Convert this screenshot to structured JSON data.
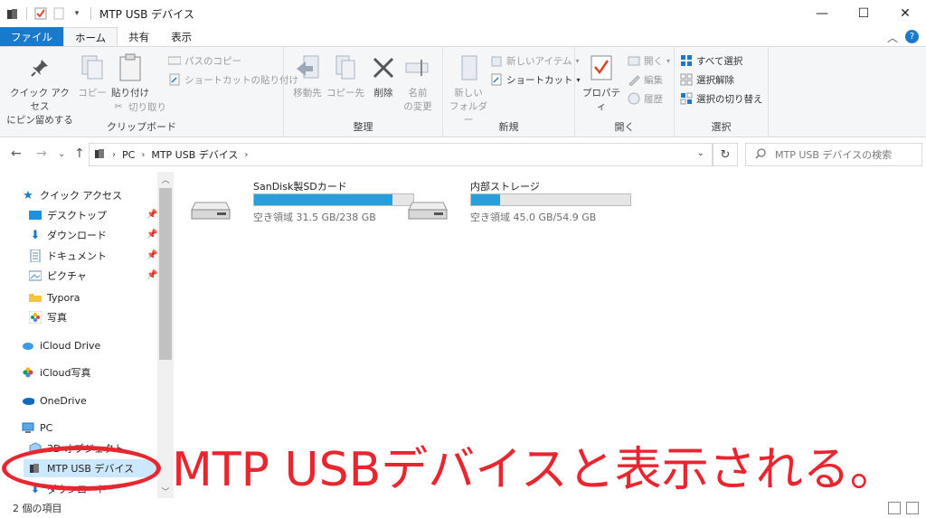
{
  "window": {
    "title": "MTP USB デバイス",
    "controls": {
      "minimize": "—",
      "maximize": "☐",
      "close": "✕"
    }
  },
  "ribbon_tabs": [
    {
      "label": "ファイル"
    },
    {
      "label": "ホーム"
    },
    {
      "label": "共有"
    },
    {
      "label": "表示"
    }
  ],
  "ribbon": {
    "clipboard": {
      "label": "クリップボード",
      "pin": "クイック アクセス\nにピン留めする",
      "copy": "コピー",
      "paste": "貼り付け",
      "copy_path": "パスのコピー",
      "paste_shortcut": "ショートカットの貼り付け",
      "cut": "切り取り"
    },
    "organize": {
      "label": "整理",
      "move_to": "移動先",
      "copy_to": "コピー先",
      "delete": "削除",
      "rename": "名前\nの変更"
    },
    "new": {
      "label": "新規",
      "new_folder": "新しい\nフォルダー",
      "new_item": "新しいアイテム",
      "shortcut": "ショートカット"
    },
    "open": {
      "label": "開く",
      "properties": "プロパティ",
      "open": "開く",
      "edit": "編集",
      "history": "履歴"
    },
    "select": {
      "label": "選択",
      "select_all": "すべて選択",
      "select_none": "選択解除",
      "invert": "選択の切り替え"
    }
  },
  "address": {
    "crumbs": [
      "PC",
      "MTP USB デバイス"
    ],
    "search_placeholder": "MTP USB デバイスの検索"
  },
  "nav": {
    "quick_access": "クイック アクセス",
    "items": [
      {
        "label": "デスクトップ",
        "pinned": true
      },
      {
        "label": "ダウンロード",
        "pinned": true
      },
      {
        "label": "ドキュメント",
        "pinned": true
      },
      {
        "label": "ピクチャ",
        "pinned": true
      },
      {
        "label": "Typora",
        "pinned": false
      },
      {
        "label": "写真",
        "pinned": false
      }
    ],
    "icloud_drive": "iCloud Drive",
    "icloud_photos": "iCloud写真",
    "onedrive": "OneDrive",
    "pc": "PC",
    "objects3d": "3D オブジェクト",
    "mtp": "MTP USB デバイス",
    "downloads2": "ダウンロード"
  },
  "drives": [
    {
      "name": "SanDisk製SDカード",
      "info": "空き領域 31.5 GB/238 GB",
      "used_fraction": 0.868
    },
    {
      "name": "内部ストレージ",
      "info": "空き領域 45.0 GB/54.9 GB",
      "used_fraction": 0.18
    }
  ],
  "status": {
    "count": "2 個の項目"
  },
  "annotation": {
    "text": "MTP USBデバイスと表示される。"
  },
  "colors": {
    "accent": "#1979ca",
    "bar_fill": "#26a0da",
    "annotation": "#e8262f"
  }
}
